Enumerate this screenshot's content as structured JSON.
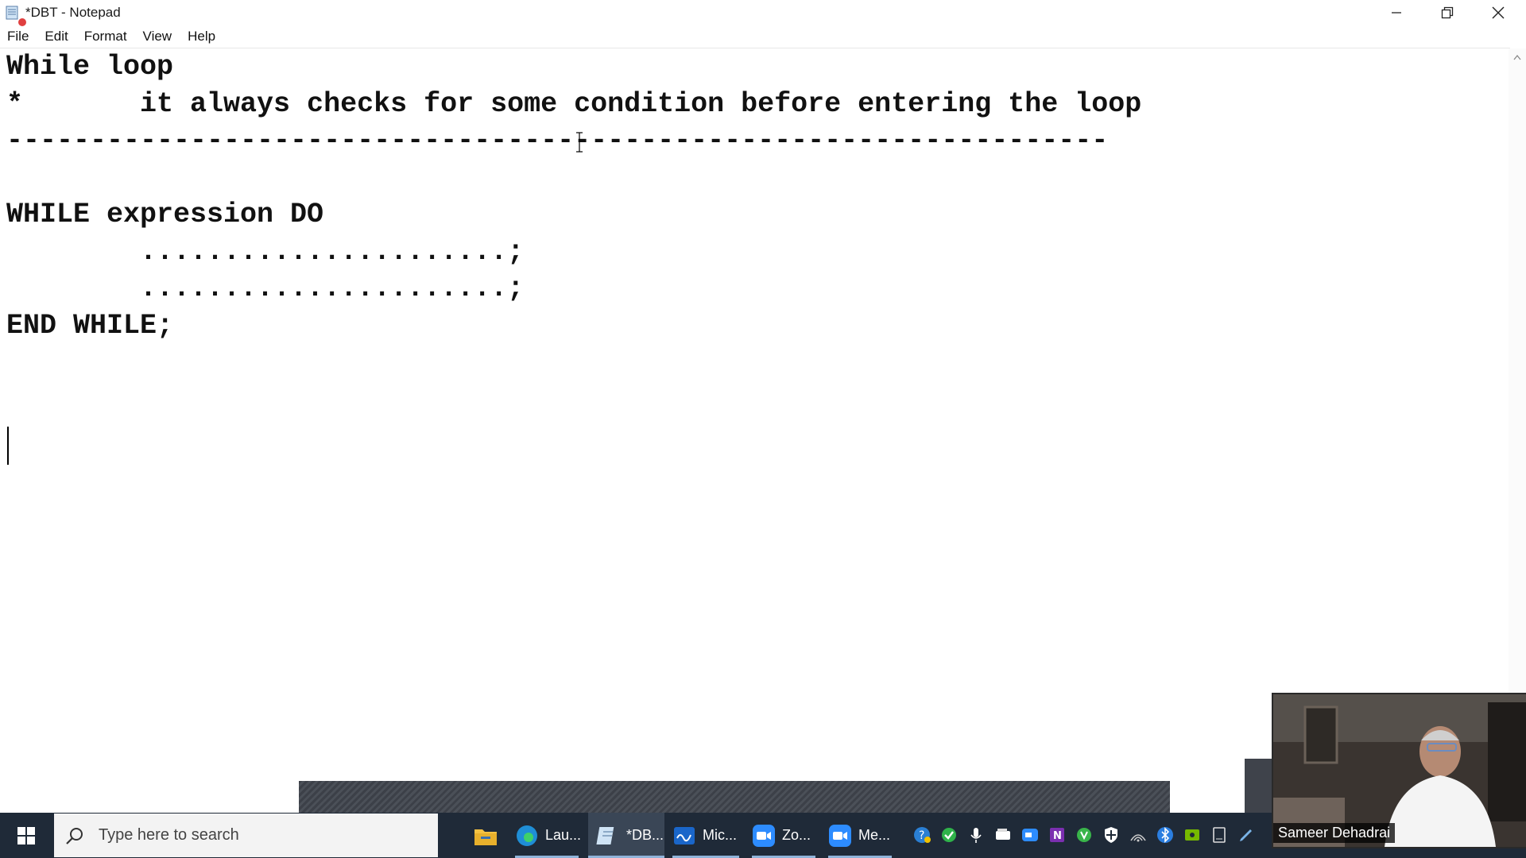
{
  "window": {
    "title": "*DBT - Notepad",
    "controls": {
      "minimize": "minimize-icon",
      "restore": "restore-icon",
      "close": "close-icon"
    }
  },
  "menu": {
    "items": [
      {
        "label": "File"
      },
      {
        "label": "Edit"
      },
      {
        "label": "Format"
      },
      {
        "label": "View"
      },
      {
        "label": "Help"
      }
    ]
  },
  "editor": {
    "content": "While loop\n*       it always checks for some condition before entering the loop\n------------------------------------------------------------------\n\nWHILE expression DO\n        ......................;\n        ......................;\nEND WHILE;"
  },
  "taskbar": {
    "search_placeholder": "Type here to search",
    "apps": [
      {
        "label": "Lau...",
        "color": "#2c8fd6"
      },
      {
        "label": "*DB...",
        "color": "#9dc3e6"
      },
      {
        "label": "Mic...",
        "color": "#1a66c9"
      },
      {
        "label": "Zo...",
        "color": "#2d8cff"
      },
      {
        "label": "Me...",
        "color": "#2d8cff"
      }
    ],
    "tray_icons": [
      "help-icon",
      "check-icon",
      "microphone-icon",
      "card-icon",
      "zoom-icon",
      "onenote-icon",
      "update-icon",
      "shield-icon",
      "wifi-icon",
      "bluetooth-icon",
      "nvidia-icon",
      "device-icon",
      "pen-icon"
    ]
  },
  "webcam": {
    "participant_name": "Sameer Dehadrai"
  },
  "colors": {
    "taskbar_bg": "#1f2a38",
    "accent": "#8fb3d9"
  }
}
